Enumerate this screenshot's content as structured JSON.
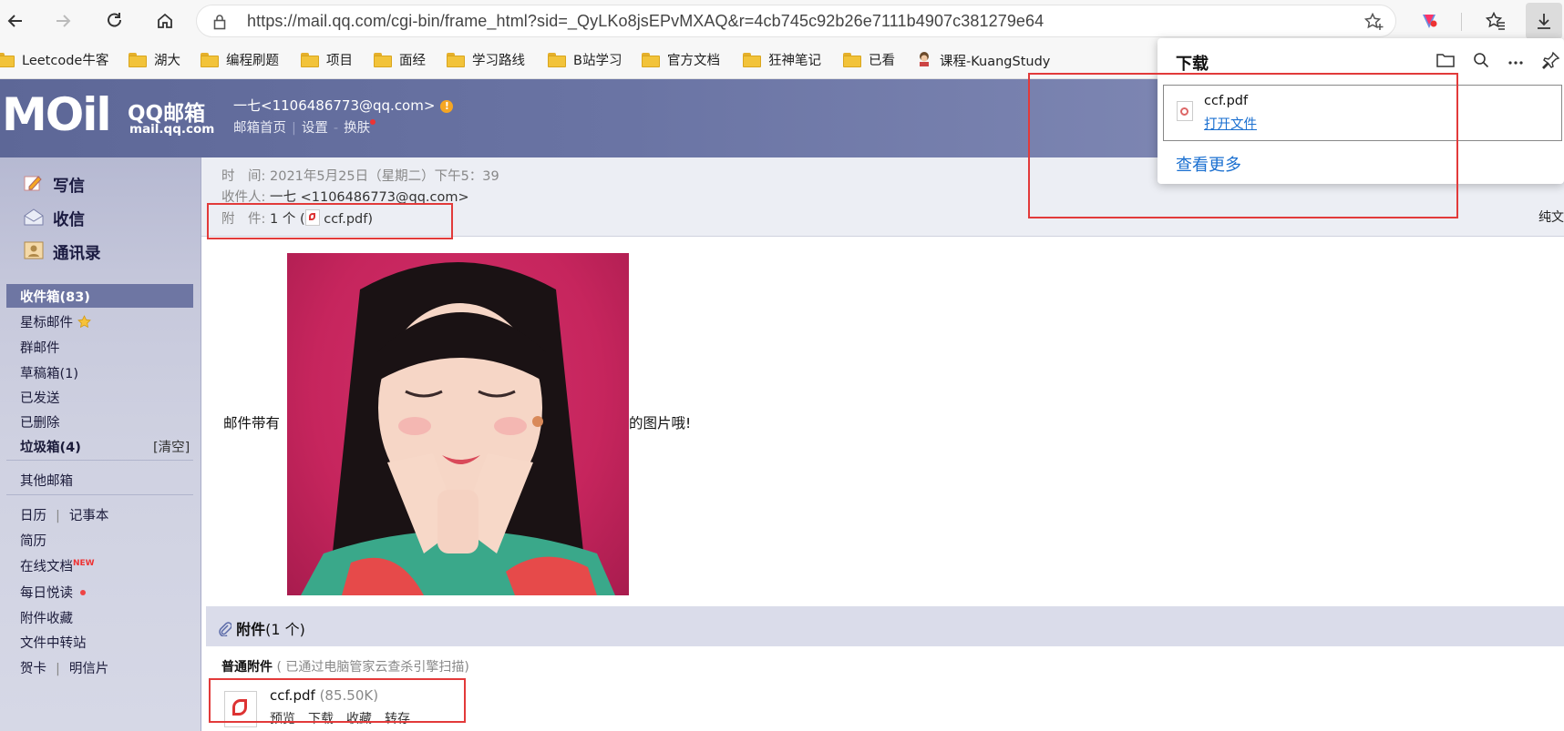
{
  "browser": {
    "url": "https://mail.qq.com/cgi-bin/frame_html?sid=_QyLKo8jsEPvMXAQ&r=4cb745c92b26e7111b4907c381279e64"
  },
  "bookmarks": [
    "Leetcode牛客",
    "湖大",
    "编程刷题",
    "项目",
    "面经",
    "学习路线",
    "B站学习",
    "官方文档",
    "狂神笔记",
    "已看",
    "课程-KuangStudy"
  ],
  "header": {
    "logo_text": "MOil",
    "logo_qq": "QQ邮箱",
    "logo_url": "mail.qq.com",
    "user": "一七<1106486773@qq.com>",
    "links": [
      "邮箱首页",
      "设置",
      "换肤"
    ]
  },
  "sidebar": {
    "compose": "写信",
    "receive": "收信",
    "contacts": "通讯录",
    "inbox": "收件箱(83)",
    "starred": "星标邮件",
    "group": "群邮件",
    "drafts": "草稿箱(1)",
    "sent": "已发送",
    "deleted": "已删除",
    "spam": "垃圾箱(4)",
    "clear": "[清空]",
    "other": "其他邮箱",
    "calendar": "日历",
    "notes": "记事本",
    "resume": "简历",
    "online_docs": "在线文档",
    "new_tag": "NEW",
    "daily": "每日悦读",
    "att_fav": "附件收藏",
    "file_transfer": "文件中转站",
    "card": "贺卡",
    "postcard": "明信片"
  },
  "mail": {
    "time_label": "时　间:",
    "time_value": "2021年5月25日（星期二）下午5：39",
    "to_label": "收件人:",
    "to_value": "一七 <1106486773@qq.com>",
    "att_label": "附　件:",
    "att_count": "1 个 (",
    "att_name": "ccf.pdf",
    "att_close": ")",
    "plain_text": "纯文",
    "body_before": "邮件带有",
    "body_after": "的图片哦!"
  },
  "attachments": {
    "title": "附件",
    "count": "(1 个)",
    "section": "普通附件",
    "scan_note": "( 已通过电脑管家云查杀引擎扫描)",
    "file_name": "ccf.pdf",
    "file_size": "(85.50K)",
    "actions": [
      "预览",
      "下载",
      "收藏",
      "转存"
    ]
  },
  "downloads": {
    "title": "下载",
    "file_name": "ccf.pdf",
    "open_label": "打开文件",
    "more_label": "查看更多"
  },
  "colors": {
    "header_bg": "#6a74a4",
    "highlight": "#e23a3a",
    "link": "#1a6fd0"
  }
}
